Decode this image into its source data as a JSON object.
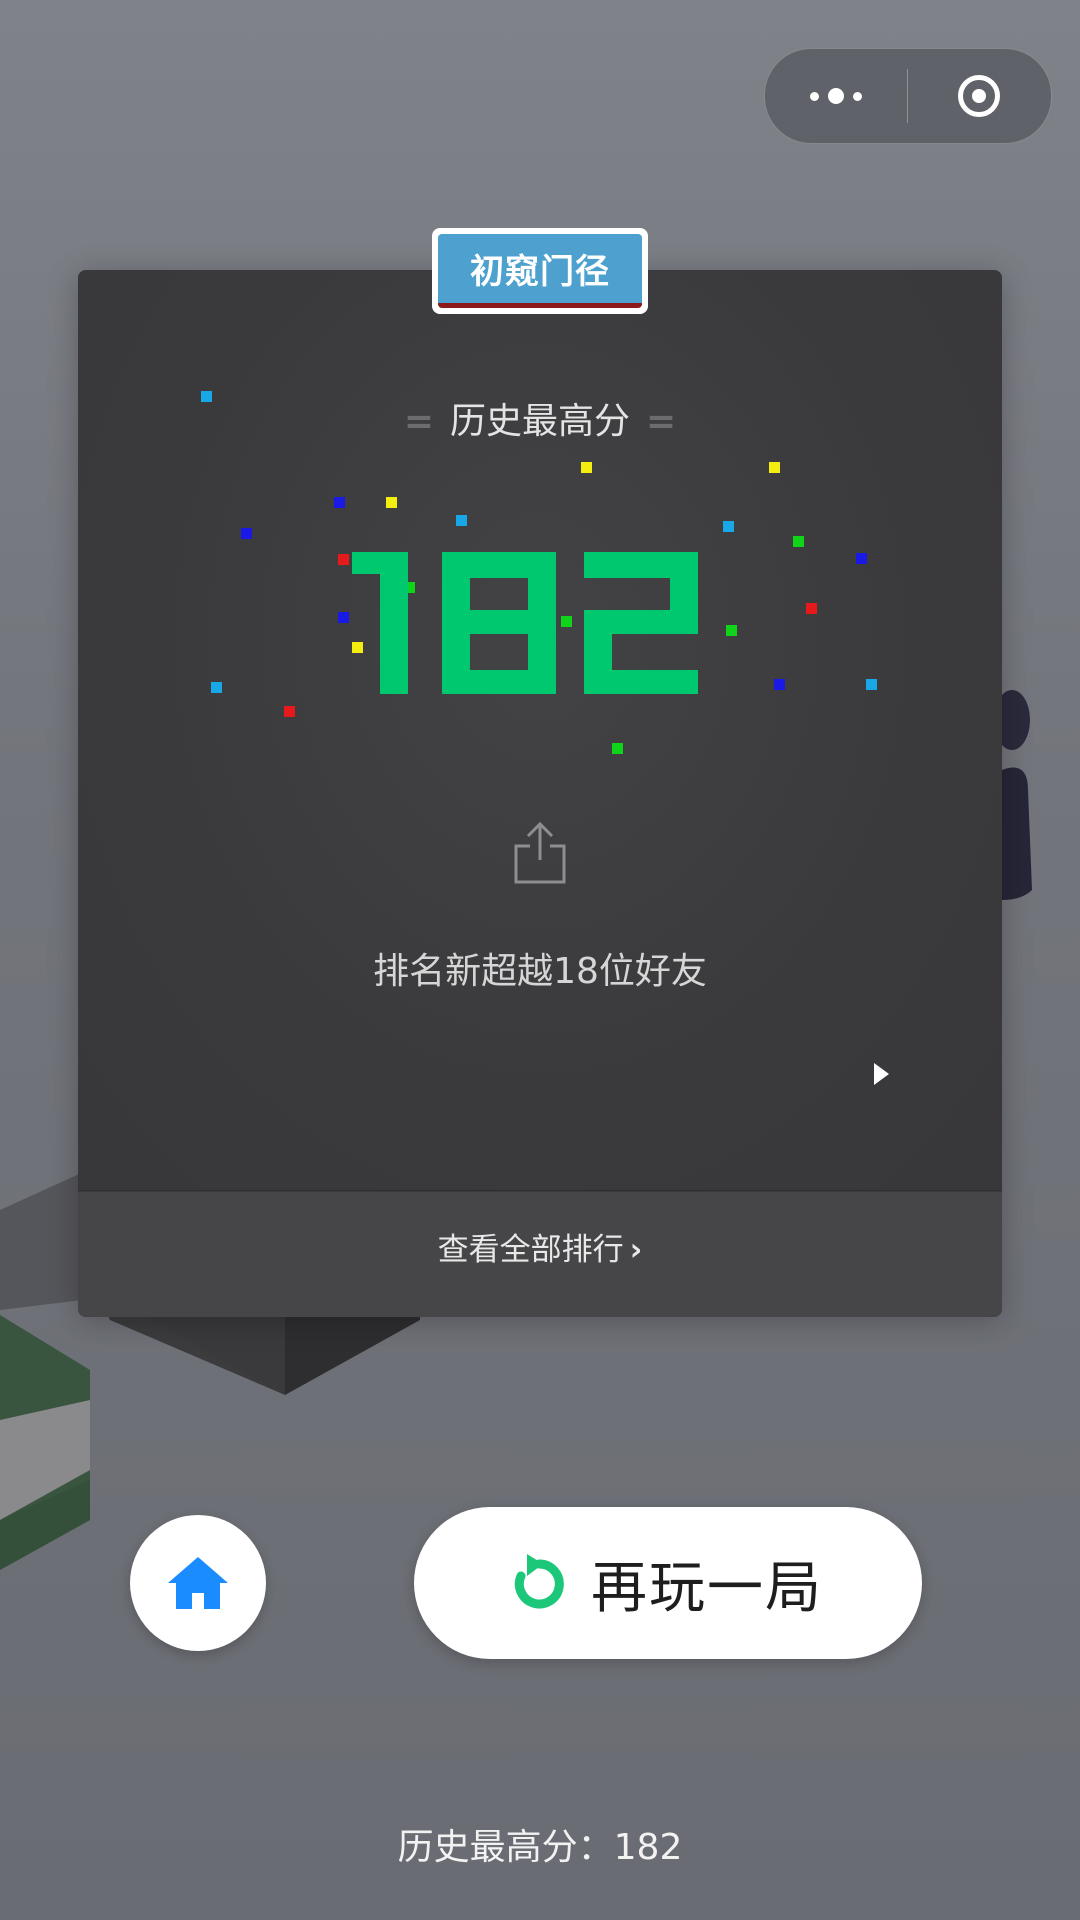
{
  "capsule": {
    "more_icon": "more-dots-icon",
    "close_icon": "target-close-icon"
  },
  "panel": {
    "badge_label": "初窥门径",
    "high_score_title": "历史最高分",
    "high_score_value": "182",
    "rank_text": "排名新超越18位好友",
    "view_all_label": "查看全部排行",
    "view_all_chevron": "›"
  },
  "actions": {
    "home_icon": "home-icon",
    "replay_label": "再玩一局",
    "replay_icon": "replay-icon"
  },
  "footer": {
    "high_score_text": "历史最高分：182"
  },
  "colors": {
    "score_green": "#00c86e",
    "badge_blue": "#4ea1cf",
    "home_blue": "#1a8cff",
    "replay_green": "#1cc77a"
  }
}
